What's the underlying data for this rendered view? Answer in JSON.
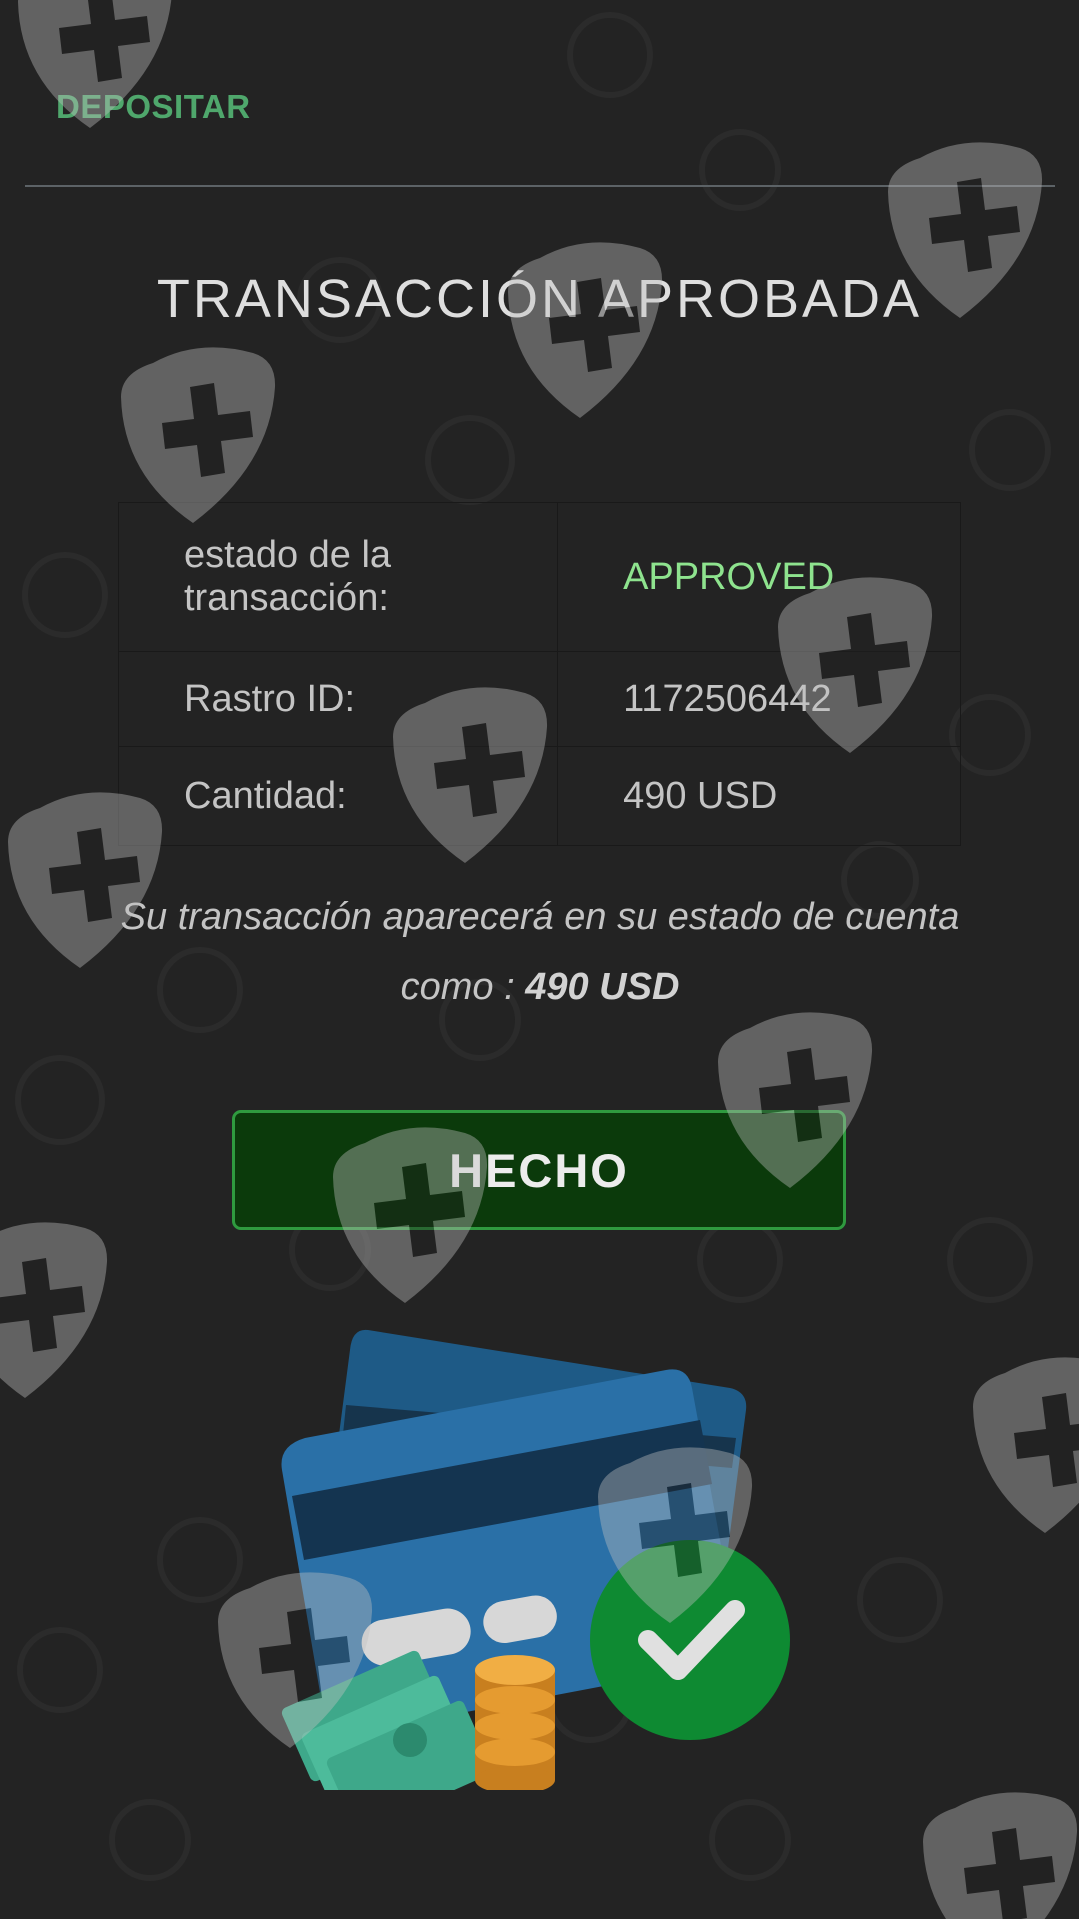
{
  "header": {
    "tab_label": "DEPOSITAR"
  },
  "title": "TRANSACCIÓN APROBADA",
  "details": {
    "status_label": "estado de la transacción:",
    "status_value": "APPROVED",
    "trace_label": "Rastro ID:",
    "trace_value": "1172506442",
    "amount_label": "Cantidad:",
    "amount_value": "490 USD"
  },
  "note": {
    "text": "Su transacción aparecerá en su estado de cuenta como : ",
    "amount": "490 USD"
  },
  "done_button_label": "HECHO",
  "colors": {
    "background": "#232323",
    "accent_green": "#4fa76c",
    "status_green": "#8ee38e",
    "button_fill": "#0b3a0b",
    "button_border": "#2f9a3f"
  },
  "icons": [
    "shield-plus-watermark-icon",
    "credit-card-icon",
    "cash-icon",
    "coins-icon",
    "check-circle-icon"
  ]
}
